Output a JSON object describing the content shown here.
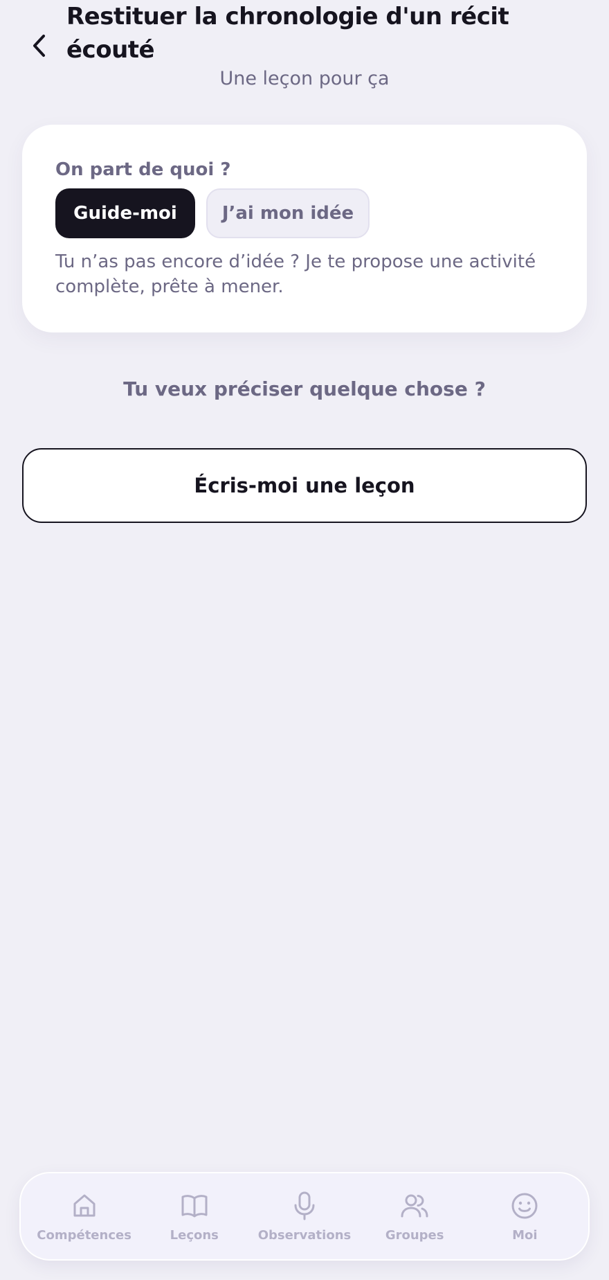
{
  "header": {
    "title": "Restituer la chronologie d'un récit écouté",
    "subtitle": "Une leçon pour ça"
  },
  "card": {
    "label": "On part de quoi ?",
    "options": [
      "Guide-moi",
      "J’ai mon idée"
    ],
    "selected": "Guide-moi",
    "description": "Tu n’as pas encore d’idée ? Je te propose une activité complète, prête à mener."
  },
  "question": "Tu veux préciser quelque chose ?",
  "cta": {
    "label": "Écris-moi une leçon"
  },
  "nav": {
    "items": [
      {
        "label": "Compétences",
        "icon": "home-icon"
      },
      {
        "label": "Leçons",
        "icon": "book-icon"
      },
      {
        "label": "Observations",
        "icon": "microphone-icon"
      },
      {
        "label": "Groupes",
        "icon": "users-icon"
      },
      {
        "label": "Moi",
        "icon": "smiley-icon"
      }
    ]
  },
  "colors": {
    "background": "#f0eff6",
    "card": "#ffffff",
    "ink": "#16141f",
    "muted": "#6c6884",
    "nav_inactive": "#b3b0c7"
  }
}
